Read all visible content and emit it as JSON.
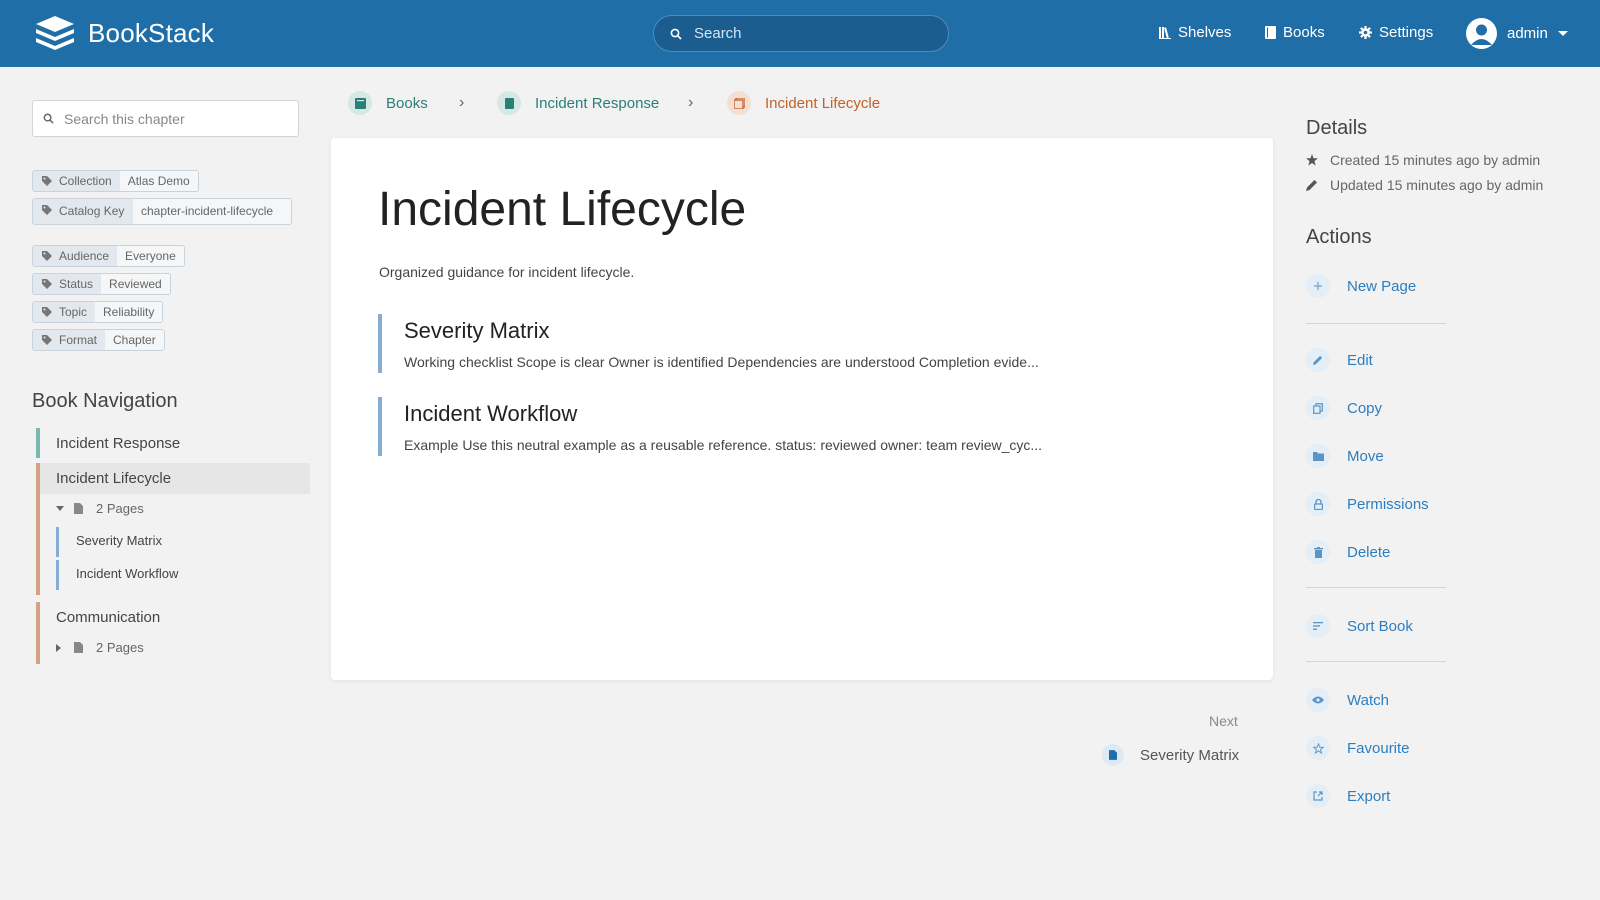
{
  "header": {
    "app_name": "BookStack",
    "search_placeholder": "Search",
    "nav": {
      "shelves": "Shelves",
      "books": "Books",
      "settings": "Settings"
    },
    "user_name": "admin"
  },
  "left": {
    "chapter_search_placeholder": "Search this chapter",
    "tags": [
      {
        "name": "Collection",
        "value": "Atlas Demo"
      },
      {
        "name": "Catalog Key",
        "value": "chapter-incident-lifecycle"
      },
      {
        "name": "Audience",
        "value": "Everyone"
      },
      {
        "name": "Status",
        "value": "Reviewed"
      },
      {
        "name": "Topic",
        "value": "Reliability"
      },
      {
        "name": "Format",
        "value": "Chapter"
      }
    ],
    "book_nav_title": "Book Navigation",
    "book_nav": {
      "item1": "Incident Response",
      "item2": "Incident Lifecycle",
      "item2_pages": "2 Pages",
      "page1": "Severity Matrix",
      "page2": "Incident Workflow",
      "item3": "Communication",
      "item3_pages": "2 Pages"
    }
  },
  "breadcrumb": {
    "books": "Books",
    "book": "Incident Response",
    "chapter": "Incident Lifecycle"
  },
  "main": {
    "title": "Incident Lifecycle",
    "description": "Organized guidance for incident lifecycle.",
    "entries": [
      {
        "title": "Severity Matrix",
        "excerpt": "Working checklist Scope is clear Owner is identified Dependencies are understood Completion evide..."
      },
      {
        "title": "Incident Workflow",
        "excerpt": "Example Use this neutral example as a reusable reference. status: reviewed owner: team review_cyc..."
      }
    ],
    "next_label": "Next",
    "next_title": "Severity Matrix"
  },
  "right": {
    "details_title": "Details",
    "created": "Created 15 minutes ago by admin",
    "updated": "Updated 15 minutes ago by admin",
    "actions_title": "Actions",
    "actions": {
      "new_page": "New Page",
      "edit": "Edit",
      "copy": "Copy",
      "move": "Move",
      "permissions": "Permissions",
      "delete": "Delete",
      "sort_book": "Sort Book",
      "watch": "Watch",
      "favourite": "Favourite",
      "export": "Export"
    }
  },
  "colors": {
    "header": "#206ea7",
    "book": "#077b70",
    "chapter": "#af4d0d",
    "page": "#206ea7",
    "link": "#2c7ec0"
  }
}
